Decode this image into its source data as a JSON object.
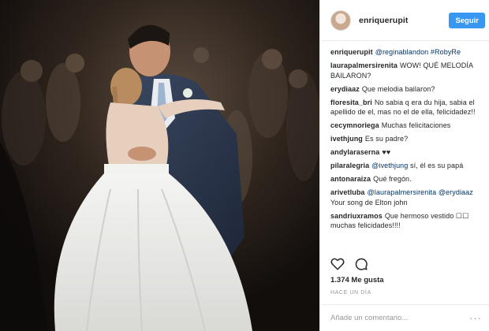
{
  "post": {
    "username": "enriquerupit",
    "follow_label": "Seguir",
    "likes": "1.374 Me gusta",
    "time_ago": "HACE UN DÍA",
    "add_comment_placeholder": "Añade un comentario...",
    "more_label": "···"
  },
  "comments": [
    {
      "user": "enriquerupit",
      "text": "@reginablandon #RobyRe"
    },
    {
      "user": "laurapalmersirenita",
      "text": "WOW! QUÉ MELODÍA BAILARON?"
    },
    {
      "user": "erydiaaz",
      "text": "Que melodia bailaron?"
    },
    {
      "user": "floresita_bri",
      "text": "No sabia q era du hija, sabia el apellido de el, mas no el de ella, felicidadez!!"
    },
    {
      "user": "cecymnoriega",
      "text": "Muchas felicitaciones"
    },
    {
      "user": "ivethjung",
      "text": "Es su padre?"
    },
    {
      "user": "andylaraserna",
      "text": "♥♥"
    },
    {
      "user": "pilaralegria",
      "text": "@ivethjung sí, él es su papá"
    },
    {
      "user": "antonaraiza",
      "text": "Qué fregón."
    },
    {
      "user": "arivetluba",
      "text": "@laurapalmersirenita @erydiaaz Your song de Elton john"
    },
    {
      "user": "sandriuxramos",
      "text": "Que hermoso vestido ☐☐ muchas felicidades!!!!"
    }
  ],
  "colors": {
    "follow_button": "#3897f0",
    "mention": "#003569",
    "muted": "#999999"
  },
  "icons": [
    "heart-icon",
    "comment-icon",
    "more-options-icon"
  ]
}
